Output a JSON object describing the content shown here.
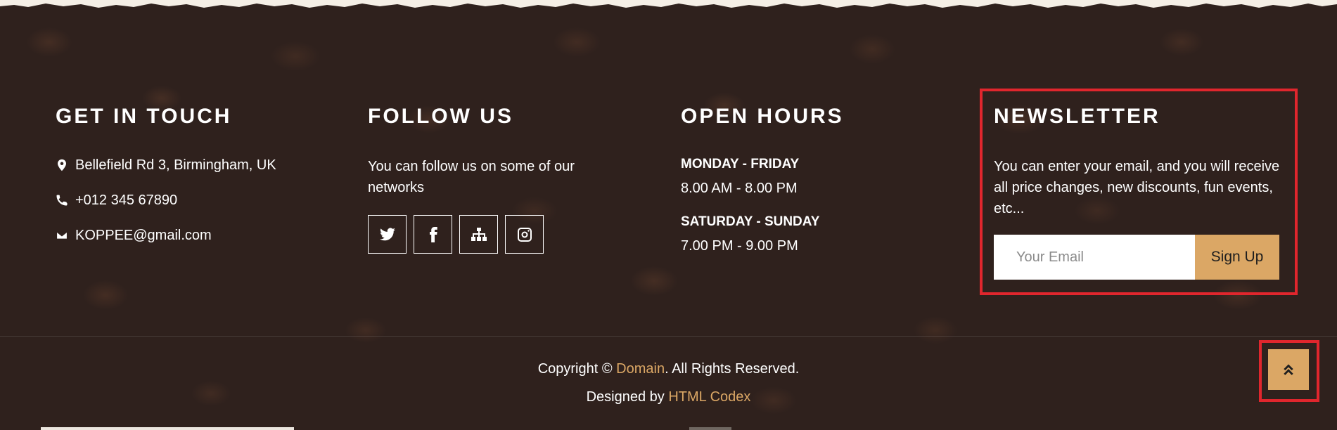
{
  "contact": {
    "heading": "GET IN TOUCH",
    "address": "Bellefield Rd 3, Birmingham, UK",
    "phone": "+012 345 67890",
    "email": "KOPPEE@gmail.com"
  },
  "follow": {
    "heading": "FOLLOW US",
    "text": "You can follow us on some of our networks",
    "icons": [
      "twitter-icon",
      "facebook-icon",
      "sitemap-icon",
      "instagram-icon"
    ]
  },
  "hours": {
    "heading": "OPEN HOURS",
    "weekday_label": "MONDAY - FRIDAY",
    "weekday_time": "8.00 AM - 8.00 PM",
    "weekend_label": "SATURDAY - SUNDAY",
    "weekend_time": "7.00 PM - 9.00 PM"
  },
  "newsletter": {
    "heading": "NEWSLETTER",
    "text": "You can enter your email, and you will receive all price changes, new discounts, fun events, etc...",
    "placeholder": "Your Email",
    "value": "",
    "button_label": "Sign Up"
  },
  "copyright": {
    "prefix": "Copyright © ",
    "domain_link": "Domain",
    "suffix": ". All Rights Reserved.",
    "designed_prefix": "Designed by ",
    "designer_link": "HTML Codex"
  },
  "colors": {
    "background": "#2f211d",
    "accent": "#dba765",
    "highlight_outline": "#e0262d"
  }
}
